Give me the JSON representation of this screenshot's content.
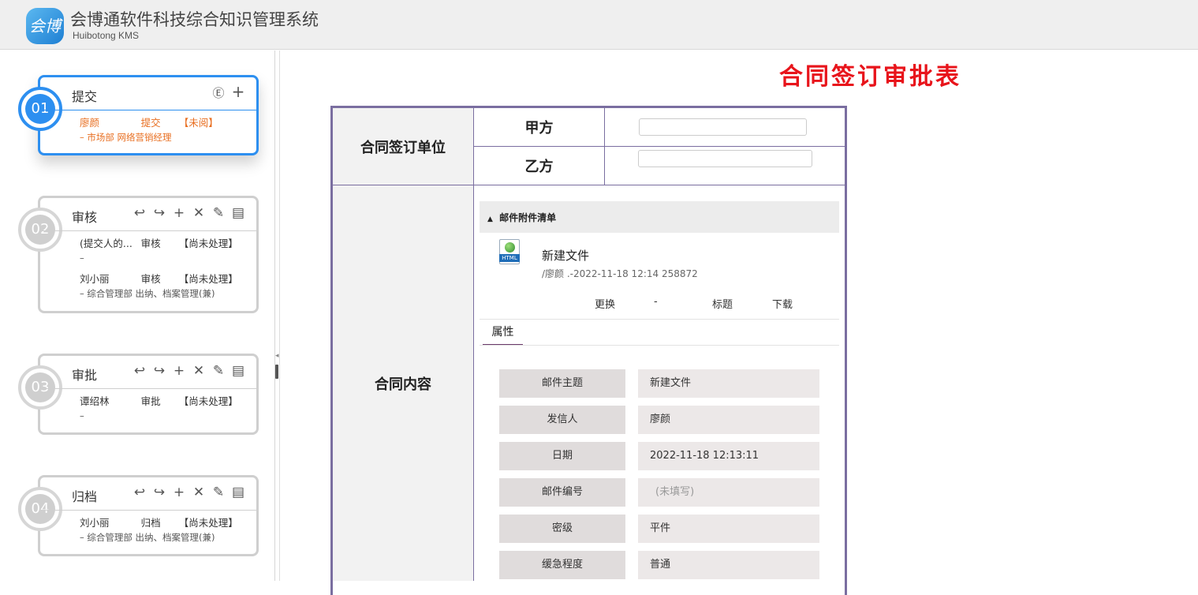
{
  "header": {
    "logo_text": "会博通",
    "title": "会博通软件科技综合知识管理系统",
    "subtitle": "Huibotong KMS"
  },
  "workflow": {
    "steps": [
      {
        "number": "01",
        "title": "提交",
        "active": true,
        "tools": [
          "circle-e-icon",
          "plus-icon"
        ],
        "entries": [
          {
            "name": "廖颜",
            "action": "提交",
            "status": "【未阅】",
            "detail": "– 市场部 网络营销经理"
          }
        ]
      },
      {
        "number": "02",
        "title": "审核",
        "active": false,
        "tools": [
          "return-icon",
          "return-alt-icon",
          "plus-icon",
          "close-icon",
          "edit-icon",
          "note-icon"
        ],
        "entries": [
          {
            "name": "(提交人的...",
            "action": "审核",
            "status": "【尚未处理】",
            "detail": "–"
          },
          {
            "name": "刘小丽",
            "action": "审核",
            "status": "【尚未处理】",
            "detail": "– 综合管理部 出纳、档案管理(兼)"
          }
        ]
      },
      {
        "number": "03",
        "title": "审批",
        "active": false,
        "tools": [
          "return-icon",
          "return-alt-icon",
          "plus-icon",
          "close-icon",
          "edit-icon",
          "note-icon"
        ],
        "entries": [
          {
            "name": "谭绍林",
            "action": "审批",
            "status": "【尚未处理】",
            "detail": "–"
          }
        ]
      },
      {
        "number": "04",
        "title": "归档",
        "active": false,
        "tools": [
          "return-icon",
          "return-alt-icon",
          "plus-icon",
          "close-icon",
          "edit-icon",
          "note-icon"
        ],
        "entries": [
          {
            "name": "刘小丽",
            "action": "归档",
            "status": "【尚未处理】",
            "detail": "– 综合管理部 出纳、档案管理(兼)"
          }
        ]
      }
    ]
  },
  "form": {
    "title": "合同签订审批表",
    "signing_unit_label": "合同签订单位",
    "party_a_label": "甲方",
    "party_a_value": "",
    "party_b_label": "乙方",
    "party_b_value": "",
    "content_label": "合同内容",
    "attachments_header": "邮件附件清单",
    "file": {
      "icon_tag": "HTML",
      "name": "新建文件",
      "meta": "/廖颜 .-2022-11-18 12:14 258872",
      "actions": [
        "更换",
        "-",
        "标题",
        "下载"
      ]
    },
    "tab_label": "属性",
    "properties": [
      {
        "label": "邮件主题",
        "value": "新建文件"
      },
      {
        "label": "发信人",
        "value": "廖颜"
      },
      {
        "label": "日期",
        "value": "2022-11-18 12:13:11"
      },
      {
        "label": "邮件编号",
        "value": "(未填写)"
      },
      {
        "label": "密级",
        "value": "平件"
      },
      {
        "label": "缓急程度",
        "value": "普通"
      }
    ]
  },
  "colors": {
    "accent": "#2d8ff0",
    "title_red": "#e8141b",
    "active_text": "#e86e20",
    "table_border": "#7a6ea0"
  }
}
